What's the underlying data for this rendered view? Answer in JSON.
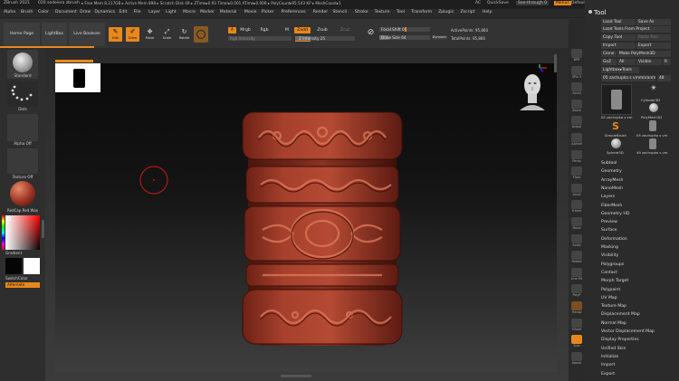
{
  "titlebar": {
    "app": "ZBrush 2021",
    "file": "020 sedeiera zbrush",
    "status": "▸ Free Mem 8.217GB ▸ Active Mem 898 ▸ Scratch Disk 49 ▸ ZTime▸0.93 Timer▸0.001 ATime▸0.006 ▸ PolyCount▸95.543 KP ▸ MeshCount▸1",
    "ac": "AC",
    "quicksave": "QuickSave",
    "seethrough": "See-through  0",
    "menus": "Menus",
    "defaultscript": "DefaultZScript"
  },
  "menubar": [
    "Alpha",
    "Brush",
    "Color",
    "Document",
    "Draw",
    "Dynamics",
    "Edit",
    "File",
    "Layer",
    "Light",
    "Macro",
    "Marker",
    "Material",
    "Movie",
    "Picker",
    "Preferences",
    "Render",
    "Stencil",
    "Stroke",
    "Texture",
    "Tool",
    "Transform",
    "Zplugin",
    "Zscript",
    "Help"
  ],
  "toolbar": {
    "home_page": "Home Page",
    "lightbox": "LightBox",
    "live_boolean": "Live Boolean",
    "edit": "Edit",
    "draw": "Draw",
    "move": "Move",
    "scale": "Scale",
    "rotate": "Rotate",
    "a": "A",
    "mrgb": "Mrgb",
    "rgb": "Rgb",
    "m": "M",
    "zadd": "Zadd",
    "zsub": "Zsub",
    "zcut": "Zcut",
    "rgb_intensity": "Rgb Intensity",
    "z_intensity": "Z Intensity 25",
    "focal_shift": "Focal Shift 0",
    "draw_size": "Draw Size 64",
    "dynamic": "Dynamic",
    "active_points": "ActivePoints: 95,860",
    "total_points": "TotalPoints: 95,860"
  },
  "leftshelf": {
    "brush": "Standard",
    "stroke": "Dots",
    "alpha": "Alpha Off",
    "texture": "Texture Off",
    "material": "RedCap Red Wax",
    "gradient": "Gradient",
    "switch_color": "SwitchColor",
    "alternate": "Alternate"
  },
  "rightshelf": [
    "BPR",
    "SPix 3",
    "Scroll",
    "Zoom",
    "Actual",
    "AAHalf",
    "Persp",
    "Floor",
    "Local",
    "Frame",
    "Move",
    "Scale",
    "Rotate",
    "Line Fill",
    "PolyF",
    "Transp",
    "Ghost",
    "Solo",
    "Xpose"
  ],
  "toolpanel": {
    "title": "Tool",
    "load_tool": "Load Tool",
    "save_as": "Save As",
    "load_from_project": "Load Tools From Project",
    "copy_tool": "Copy Tool",
    "paste_tool": "Paste Tool",
    "import": "Import",
    "export": "Export",
    "clone": "Clone",
    "make_polymesh": "Make PolyMesh3D",
    "goz": "GoZ",
    "all": "All",
    "visible": "Visible",
    "r": "R",
    "lightbox_tools": "Lightbox▸Tools",
    "current_tool": "05 zachupka s vmmoranmm",
    "current_num": "48",
    "thumb_labels": [
      "05 zachupka s vm",
      "PolyMesh3D",
      "Cylinder3D",
      "SimpleBrush",
      "05 zachupka s vm",
      "Sphere3D",
      "49 zachupka s vm"
    ],
    "thumb_counts": [
      "",
      "",
      "3",
      "",
      "",
      "",
      ""
    ],
    "sections": [
      "Subtool",
      "Geometry",
      "ArrayMesh",
      "NanoMesh",
      "Layers",
      "FiberMesh",
      "Geometry HD",
      "Preview",
      "Surface",
      "Deformation",
      "Masking",
      "Visibility",
      "Polygroups",
      "Contact",
      "Morph Target",
      "Polypaint",
      "UV Map",
      "Texture Map",
      "Displacement Map",
      "Normal Map",
      "Vector Displacement Map",
      "Display Properties",
      "Unified Skin",
      "Initialize",
      "Import",
      "Export"
    ]
  },
  "colors": {
    "accent": "#e8881c",
    "model": "#a23a2a",
    "brush_cursor": "#b01818"
  }
}
